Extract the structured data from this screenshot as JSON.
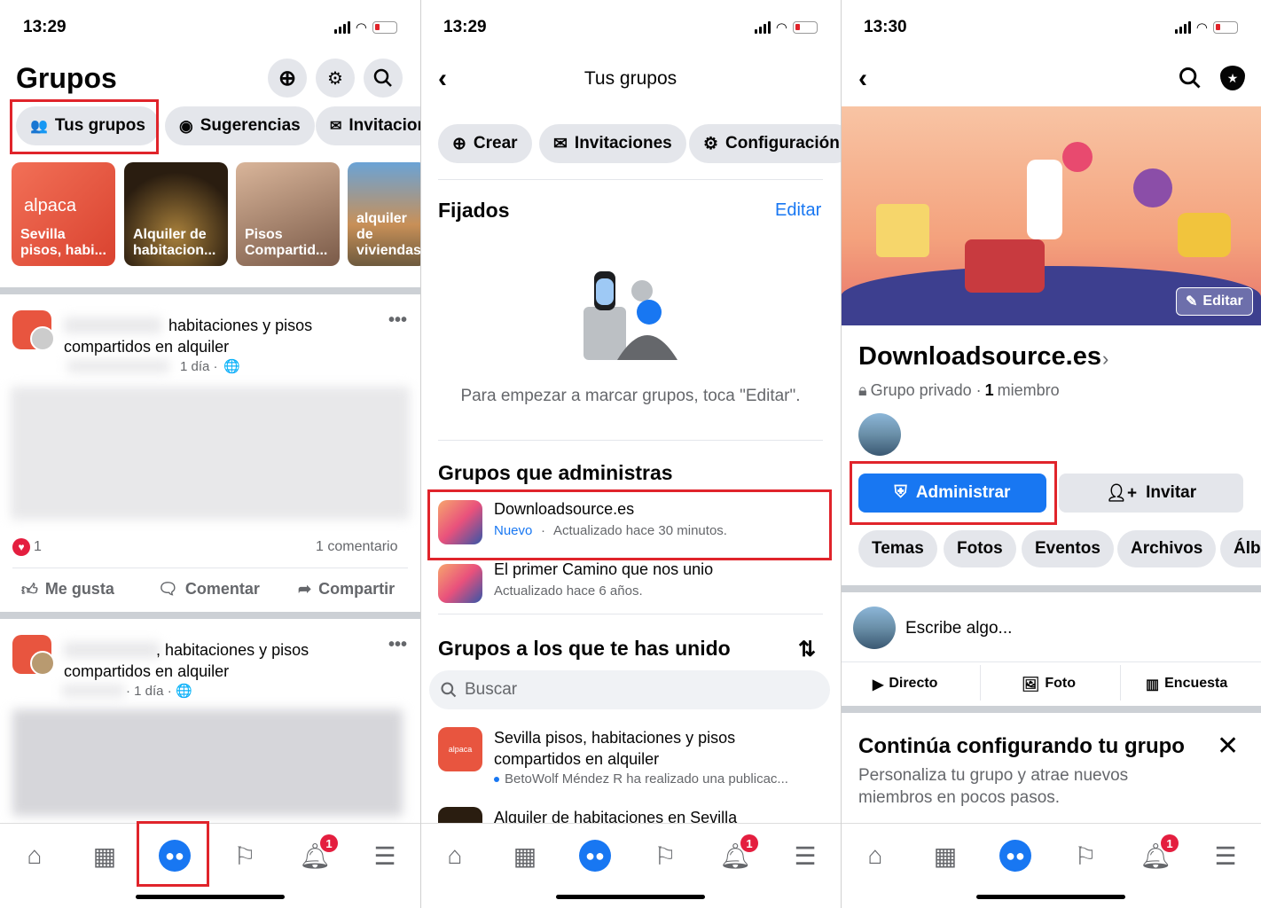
{
  "status": [
    {
      "time": "13:29"
    },
    {
      "time": "13:29"
    },
    {
      "time": "13:30"
    }
  ],
  "panel1": {
    "title": "Grupos",
    "chips": [
      "Tus grupos",
      "Sugerencias",
      "Invitaciones"
    ],
    "cards": [
      {
        "brand": "alpaca",
        "sub": "Sevilla",
        "label": "Sevilla pisos, habi..."
      },
      {
        "label": "Alquiler de habitacion..."
      },
      {
        "label": "Pisos Compartid..."
      },
      {
        "label": "alquiler de viviendas"
      }
    ],
    "post1": {
      "title_visible": "habitaciones y pisos compartidos en alquiler",
      "time": "1 día ·",
      "likes": "1",
      "comments": "1 comentario"
    },
    "actions": [
      "Me gusta",
      "Comentar",
      "Compartir"
    ],
    "post2": {
      "title_visible": ", habitaciones y pisos compartidos en alquiler",
      "time": "· 1 día ·"
    }
  },
  "panel2": {
    "title": "Tus grupos",
    "chips": [
      "Crear",
      "Invitaciones",
      "Configuración"
    ],
    "pinned_title": "Fijados",
    "edit": "Editar",
    "pinned_hint": "Para empezar a marcar grupos, toca \"Editar\".",
    "admin_title": "Grupos que administras",
    "admin_groups": [
      {
        "name": "Downloadsource.es",
        "badge": "Nuevo",
        "sub": "Actualizado hace 30 minutos."
      },
      {
        "name": "El primer Camino que nos unio",
        "sub": "Actualizado hace 6 años."
      }
    ],
    "joined_title": "Grupos a los que te has unido",
    "search_placeholder": "Buscar",
    "joined_groups": [
      {
        "name": "Sevilla pisos, habitaciones y pisos compartidos en alquiler",
        "sub": "BetoWolf Méndez R ha realizado una publicac...",
        "brand": "alpaca"
      },
      {
        "name": "Alquiler de habitaciones en Sevilla"
      }
    ]
  },
  "panel3": {
    "edit_cover": "Editar",
    "group_name": "Downloadsource.es",
    "privacy": "Grupo privado ·",
    "members_count": "1",
    "members_label": "miembro",
    "admin_button": "Administrar",
    "invite_button": "Invitar",
    "tabs": [
      "Temas",
      "Fotos",
      "Eventos",
      "Archivos",
      "Álbumes"
    ],
    "composer_placeholder": "Escribe algo...",
    "composer_actions": [
      "Directo",
      "Foto",
      "Encuesta"
    ],
    "setup_title": "Continúa configurando tu grupo",
    "setup_sub": "Personaliza tu grupo y atrae nuevos miembros en pocos pasos."
  },
  "nav": {
    "badge": "1"
  },
  "colors": {
    "accent": "#1877f2",
    "highlight": "#e0242b",
    "chip": "#e4e6eb",
    "text": "#050505",
    "secondary": "#65676b"
  }
}
